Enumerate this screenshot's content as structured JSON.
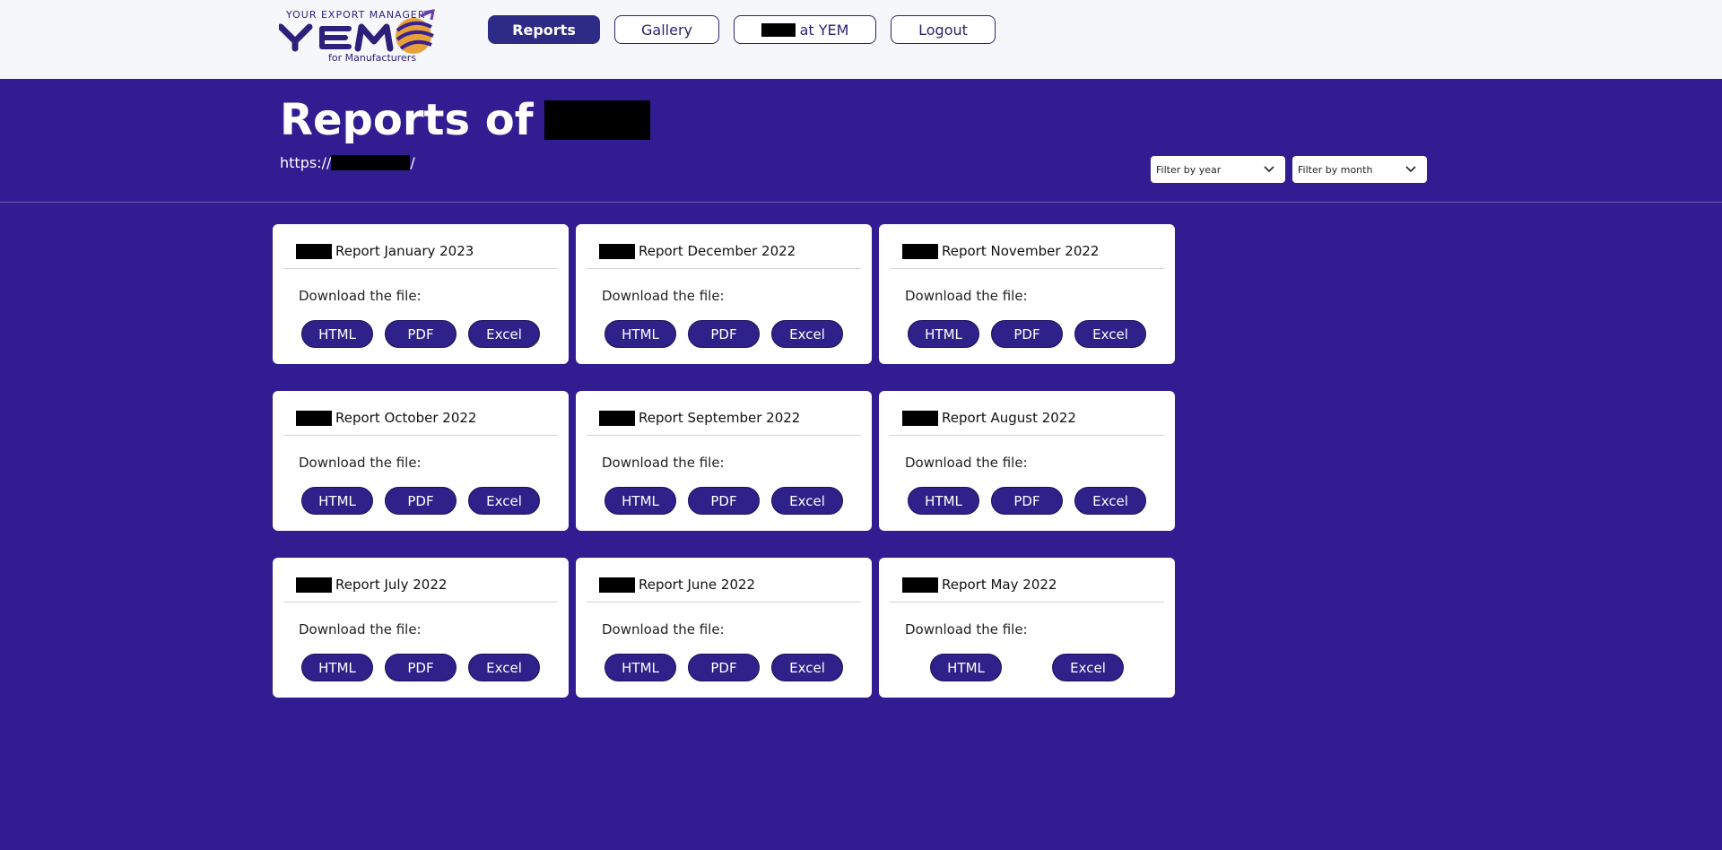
{
  "header": {
    "logo_tagline": "YOUR EXPORT MANAGER",
    "logo_text": "YEM",
    "logo_sub": "for Manufacturers",
    "nav": [
      {
        "label": "Reports",
        "active": true
      },
      {
        "label": "Gallery",
        "active": false
      },
      {
        "label": "at YEM",
        "active": false,
        "redacted_prefix": true
      },
      {
        "label": "Logout",
        "active": false
      }
    ]
  },
  "page": {
    "title": "Reports of",
    "url_prefix": "https://",
    "url_suffix": "/",
    "filter_year_label": "Filter by year",
    "filter_month_label": "Filter by month"
  },
  "reports": [
    {
      "title": "Report January 2023",
      "download_label": "Download the file:",
      "formats": [
        "HTML",
        "PDF",
        "Excel"
      ]
    },
    {
      "title": "Report December 2022",
      "download_label": "Download the file:",
      "formats": [
        "HTML",
        "PDF",
        "Excel"
      ]
    },
    {
      "title": "Report November 2022",
      "download_label": "Download the file:",
      "formats": [
        "HTML",
        "PDF",
        "Excel"
      ]
    },
    {
      "title": "Report October 2022",
      "download_label": "Download the file:",
      "formats": [
        "HTML",
        "PDF",
        "Excel"
      ]
    },
    {
      "title": "Report September 2022",
      "download_label": "Download the file:",
      "formats": [
        "HTML",
        "PDF",
        "Excel"
      ]
    },
    {
      "title": "Report August 2022",
      "download_label": "Download the file:",
      "formats": [
        "HTML",
        "PDF",
        "Excel"
      ]
    },
    {
      "title": "Report July 2022",
      "download_label": "Download the file:",
      "formats": [
        "HTML",
        "PDF",
        "Excel"
      ]
    },
    {
      "title": "Report June 2022",
      "download_label": "Download the file:",
      "formats": [
        "HTML",
        "PDF",
        "Excel"
      ]
    },
    {
      "title": "Report May 2022",
      "download_label": "Download the file:",
      "formats": [
        "HTML",
        "Excel"
      ]
    }
  ],
  "colors": {
    "background": "#311d91",
    "header_bg": "#f6f7fb",
    "button": "#2e2189",
    "accent_orange": "#e8a13a"
  }
}
